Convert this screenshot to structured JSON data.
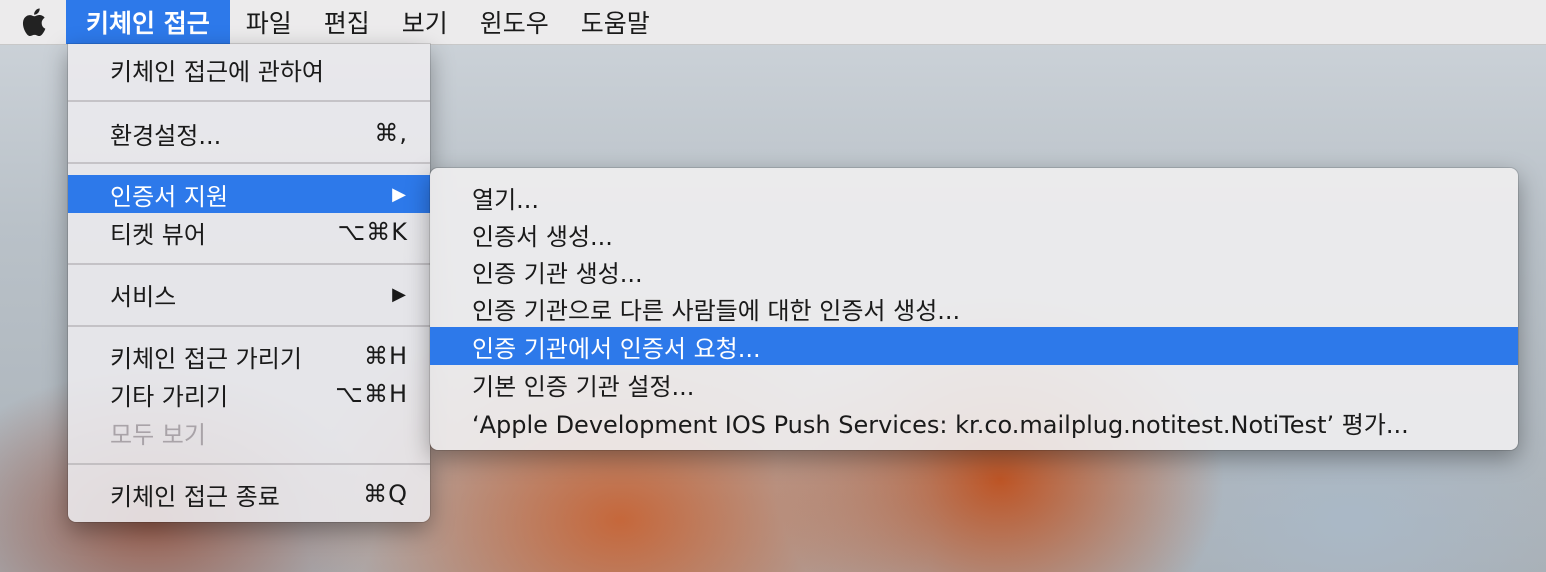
{
  "menubar": {
    "items": [
      {
        "label": "키체인 접근",
        "active": true
      },
      {
        "label": "파일"
      },
      {
        "label": "편집"
      },
      {
        "label": "보기"
      },
      {
        "label": "윈도우"
      },
      {
        "label": "도움말"
      }
    ]
  },
  "menu": {
    "about": "키체인 접근에 관하여",
    "preferences": {
      "label": "환경설정...",
      "shortcut": "⌘,"
    },
    "cert_assistant": {
      "label": "인증서 지원",
      "arrow": "▶"
    },
    "ticket_viewer": {
      "label": "티켓 뷰어",
      "shortcut": "⌥⌘K"
    },
    "services": {
      "label": "서비스",
      "arrow": "▶"
    },
    "hide": {
      "label": "키체인 접근 가리기",
      "shortcut": "⌘H"
    },
    "hide_others": {
      "label": "기타 가리기",
      "shortcut": "⌥⌘H"
    },
    "show_all": {
      "label": "모두 보기"
    },
    "quit": {
      "label": "키체인 접근 종료",
      "shortcut": "⌘Q"
    }
  },
  "submenu": {
    "items": [
      "열기...",
      "인증서 생성...",
      "인증 기관 생성...",
      "인증 기관으로 다른 사람들에 대한 인증서 생성...",
      "인증 기관에서 인증서 요청...",
      "기본 인증 기관 설정...",
      "‘Apple Development IOS Push Services: kr.co.mailplug.notitest.NotiTest’ 평가..."
    ]
  },
  "colors": {
    "highlight": "#2d79ea",
    "disabled_text": "#a9a3a8"
  }
}
